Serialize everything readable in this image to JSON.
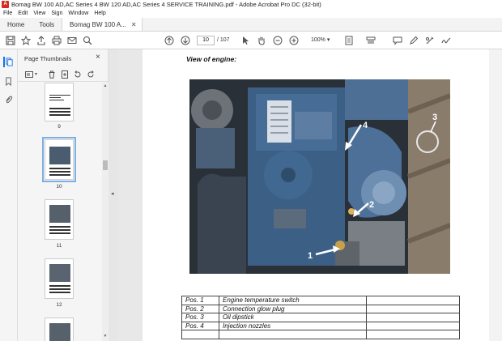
{
  "window": {
    "title": "Bomag  BW 100 AD,AC Series 4 BW 120 AD,AC Series 4 SERVICE TRAINING.pdf - Adobe Acrobat Pro DC (32-bit)"
  },
  "menu": [
    "File",
    "Edit",
    "View",
    "Sign",
    "Window",
    "Help"
  ],
  "tabs": [
    {
      "label": "Home"
    },
    {
      "label": "Tools"
    },
    {
      "label": "Bomag  BW 100 A..."
    }
  ],
  "toolbar": {
    "current_page": "10",
    "total_pages": "/ 107",
    "zoom": "100%"
  },
  "panel": {
    "title": "Page Thumbnails",
    "thumbnails": [
      {
        "num": "9"
      },
      {
        "num": "10"
      },
      {
        "num": "11"
      },
      {
        "num": "12"
      }
    ]
  },
  "document": {
    "heading": "View of engine:",
    "callouts": [
      "1",
      "2",
      "3",
      "4"
    ],
    "positions": [
      {
        "pos": "Pos. 1",
        "desc": "Engine temperature switch",
        "extra": ""
      },
      {
        "pos": "Pos. 2",
        "desc": "Connection glow plug",
        "extra": ""
      },
      {
        "pos": "Pos. 3",
        "desc": "Oil dipstick",
        "extra": ""
      },
      {
        "pos": "Pos. 4",
        "desc": "Injection nozzles",
        "extra": ""
      },
      {
        "pos": "",
        "desc": "",
        "extra": ""
      }
    ]
  },
  "colors": {
    "accent": "#1473e6",
    "engine_blue": "#3c5f86",
    "pdf_icon": "#d42b20"
  }
}
